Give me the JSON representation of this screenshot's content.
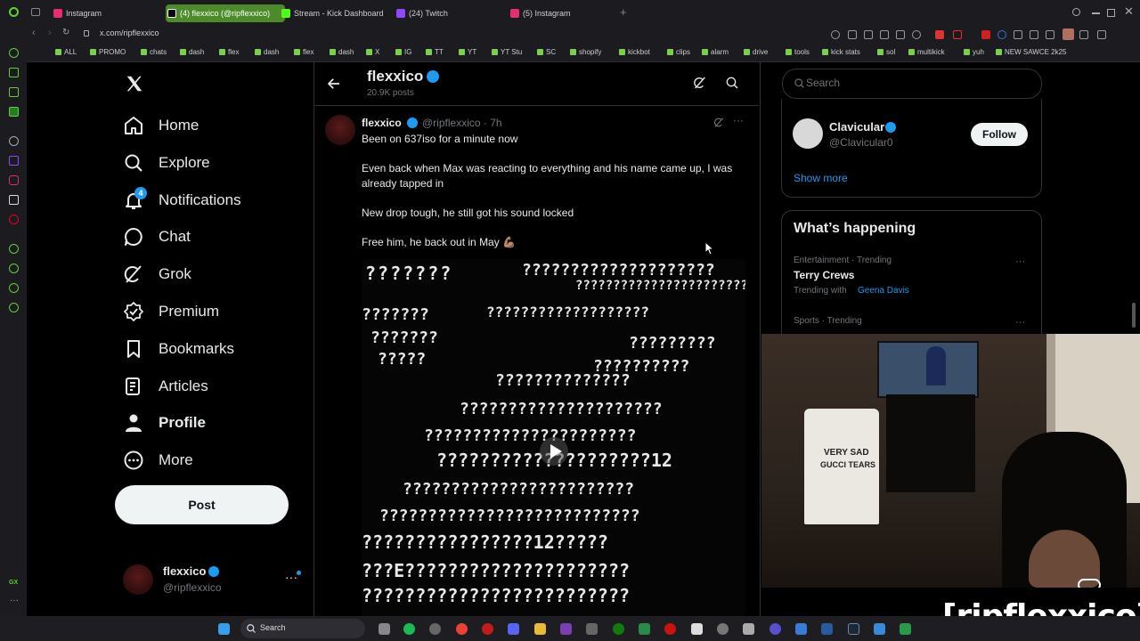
{
  "browser": {
    "tabs": [
      {
        "label": "Instagram",
        "color": "#e1306c"
      },
      {
        "label": "(4) flexxico (@ripflexxico)",
        "color": "#ffffff",
        "active": true
      },
      {
        "label": "Stream - Kick Dashboard",
        "color": "#53fc18"
      },
      {
        "label": "(24) Twitch",
        "color": "#9146ff"
      },
      {
        "label": "(5) Instagram",
        "color": "#e1306c"
      }
    ],
    "url": "x.com/ripflexxico",
    "bookmarks": [
      "ALL",
      "PROMO",
      "chats",
      "dash",
      "flex",
      "dash",
      "flex",
      "dash",
      "X",
      "IG",
      "TT",
      "YT",
      "YT Stu",
      "SC",
      "shopify",
      "kickbot",
      "clips",
      "alarm",
      "drive",
      "tools",
      "kick stats",
      "sol",
      "multikick",
      "yuh",
      "NEW SAWCE 2k25"
    ]
  },
  "nav": {
    "items": [
      {
        "label": "Home",
        "icon": "home-icon"
      },
      {
        "label": "Explore",
        "icon": "search-icon"
      },
      {
        "label": "Notifications",
        "icon": "bell-icon",
        "badge": "4"
      },
      {
        "label": "Chat",
        "icon": "chat-icon"
      },
      {
        "label": "Grok",
        "icon": "grok-icon"
      },
      {
        "label": "Premium",
        "icon": "premium-icon"
      },
      {
        "label": "Bookmarks",
        "icon": "bookmark-icon"
      },
      {
        "label": "Articles",
        "icon": "articles-icon"
      },
      {
        "label": "Profile",
        "icon": "profile-icon"
      },
      {
        "label": "More",
        "icon": "more-icon"
      }
    ],
    "post_label": "Post",
    "account_name": "flexxico",
    "account_handle": "@ripflexxico"
  },
  "header": {
    "title": "flexxico",
    "posts_count": "20.9K posts"
  },
  "tweet": {
    "name": "flexxico",
    "handle_time": "@ripflexxico · 7h",
    "lines": [
      "Been on 637iso for a minute now",
      "Even back when Max was reacting to everything and his name came up, I was already tapped in",
      "New drop tough, he still got his sound locked",
      "Free him, he back out in May 💪🏽"
    ]
  },
  "right": {
    "search_placeholder": "Search",
    "follow_name": "Clavicular",
    "follow_handle": "@Clavicular0",
    "follow_label": "Follow",
    "show_more": "Show more",
    "happening_title": "What’s happening",
    "trend1_meta": "Entertainment · Trending",
    "trend1_title": "Terry Crews",
    "trend1_with_prefix": "Trending with",
    "trend1_with": "Geena Davis",
    "trend2_meta": "Sports · Trending"
  },
  "overlay": {
    "watermark": "[ripflexxico]",
    "shirt_line1": "VERY SAD",
    "shirt_line2": "GUCCI TEARS"
  },
  "taskbar": {
    "search_label": "Search"
  },
  "colors": {
    "accent": "#1d9bf0",
    "verified": "#1d9bf0",
    "brand": "#4c8a2a"
  }
}
